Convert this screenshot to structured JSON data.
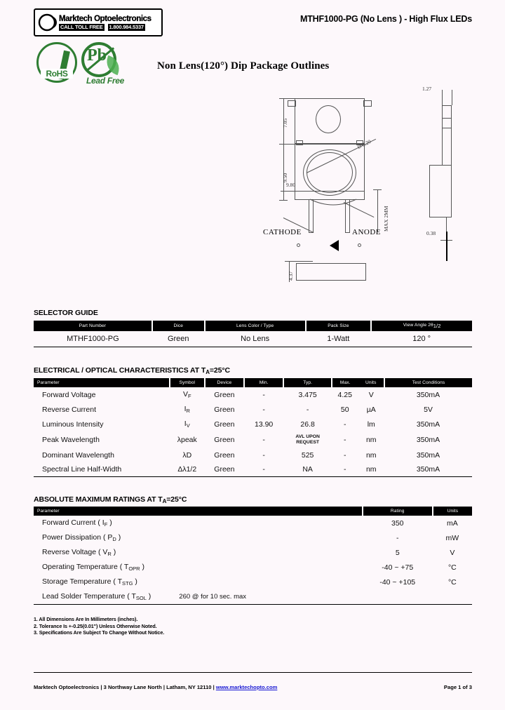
{
  "header": {
    "company": "Marktech Optoelectronics",
    "toll_free_label": "CALL TOLL FREE",
    "toll_free_number": "1.800.984.5337",
    "doc_title": "MTHF1000-PG (No Lens ) - High Flux LEDs"
  },
  "badges": {
    "rohs": "RoHS",
    "pb_symbol": "Pb",
    "lead_free": "Lead Free",
    "green_color": "#2e7d32"
  },
  "drawing": {
    "title": "Non Lens(120°) Dip Package Outlines",
    "dim_height_top": "7.05",
    "dim_height_bottom": "9.50",
    "dim_width": "9.80",
    "dim_diameter": "Ø 8.20",
    "dim_max": "MAX 2MM",
    "dim_bottom_height": "4.37",
    "label_cathode": "CATHODE",
    "label_anode": "ANODE",
    "side_dim_top": "1.27",
    "side_dim_bottom": "0.38"
  },
  "selector_guide": {
    "heading": "SELECTOR GUIDE",
    "columns": [
      "Part Number",
      "Dice",
      "Lens Color / Type",
      "Pack Size",
      "View Angle 2θ1/2"
    ],
    "rows": [
      [
        "MTHF1000-PG",
        "Green",
        "No Lens",
        "1-Watt",
        "120 °"
      ]
    ]
  },
  "electrical": {
    "heading_pre": "ELECTRICAL / OPTICAL CHARACTERISTICS AT T",
    "heading_sub": "A",
    "heading_post": "=25°C",
    "columns": [
      "Parameter",
      "Symbol",
      "Device",
      "Min.",
      "Typ.",
      "Max.",
      "Units",
      "Test Conditions"
    ],
    "rows": [
      {
        "parameter": "Forward Voltage",
        "symbol": "V",
        "symbol_sub": "F",
        "device": "Green",
        "min": "-",
        "typ": "3.475",
        "max": "4.25",
        "units": "V",
        "conditions": "350mA"
      },
      {
        "parameter": "Reverse Current",
        "symbol": "I",
        "symbol_sub": "R",
        "device": "Green",
        "min": "-",
        "typ": "-",
        "max": "50",
        "units": "µA",
        "conditions": "5V"
      },
      {
        "parameter": "Luminous Intensity",
        "symbol": "I",
        "symbol_sub": "V",
        "device": "Green",
        "min": "13.90",
        "typ": "26.8",
        "max": "-",
        "units": "lm",
        "conditions": "350mA"
      },
      {
        "parameter": "Peak Wavelength",
        "symbol": "λpeak",
        "symbol_sub": "",
        "device": "Green",
        "min": "-",
        "typ": "AVL UPON REQUEST",
        "max": "-",
        "units": "nm",
        "conditions": "350mA"
      },
      {
        "parameter": "Dominant Wavelength",
        "symbol": "λD",
        "symbol_sub": "",
        "device": "Green",
        "min": "-",
        "typ": "525",
        "max": "-",
        "units": "nm",
        "conditions": "350mA"
      },
      {
        "parameter": "Spectral Line Half-Width",
        "symbol": "Δλ1/2",
        "symbol_sub": "",
        "device": "Green",
        "min": "-",
        "typ": "NA",
        "max": "-",
        "units": "nm",
        "conditions": "350mA"
      }
    ]
  },
  "absolute_max": {
    "heading_pre": "ABSOLUTE MAXIMUM RATINGS AT T",
    "heading_sub": "A",
    "heading_post": "=25°C",
    "columns": [
      "Parameter",
      "Rating",
      "Units"
    ],
    "rows": [
      {
        "parameter": "Forward Current ( I",
        "sub": "F",
        "suffix": " )",
        "extra": "",
        "rating": "350",
        "units": "mA"
      },
      {
        "parameter": "Power Dissipation ( P",
        "sub": "D",
        "suffix": " )",
        "extra": "",
        "rating": "-",
        "units": "mW"
      },
      {
        "parameter": "Reverse Voltage ( V",
        "sub": "R",
        "suffix": " )",
        "extra": "",
        "rating": "5",
        "units": "V"
      },
      {
        "parameter": "Operating Temperature ( T",
        "sub": "OPR",
        "suffix": " )",
        "extra": "",
        "rating": "-40 ~ +75",
        "units": "°C"
      },
      {
        "parameter": "Storage Temperature ( T",
        "sub": "STG",
        "suffix": " )",
        "extra": "",
        "rating": "-40 ~ +105",
        "units": "°C"
      },
      {
        "parameter": "Lead Solder Temperature ( T",
        "sub": "SOL",
        "suffix": " )",
        "extra": "260   @ for 10 sec. max",
        "rating": "",
        "units": ""
      }
    ]
  },
  "notes": [
    "1. All Dimensions Are In Millimeters (inches).",
    "2. Tolerance Is +-0.25(0.01\") Unless Otherwise Noted.",
    "3. Specifications Are Subject To Change Without Notice."
  ],
  "footer": {
    "address": "Marktech Optoelectronics | 3 Northway Lane North | Latham, NY 12110 | ",
    "url": "www.marktechopto.com",
    "page": "Page 1 of 3",
    "link_color": "#1414d2"
  }
}
